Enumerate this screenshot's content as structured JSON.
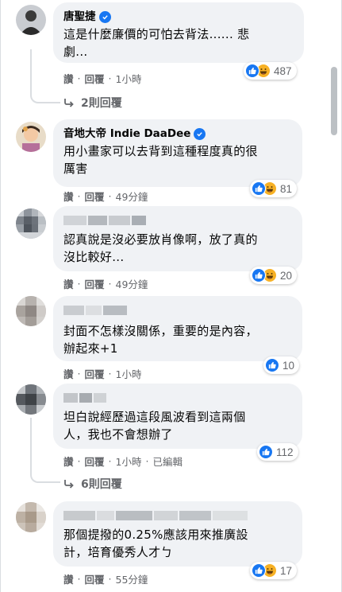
{
  "comments": [
    {
      "author": "唐聖捷",
      "verified": true,
      "text_lines": [
        "這是什麼廉價的可怕去背法...... 悲",
        "劇..."
      ],
      "reactions": {
        "icons": [
          "like-icon",
          "haha-icon"
        ],
        "count": "487"
      },
      "actions": {
        "like": "讚",
        "reply": "回覆",
        "time": "1小時"
      },
      "replies_label": "2則回覆"
    },
    {
      "author": "音地大帝 Indie DaaDee",
      "verified": true,
      "text_lines": [
        "用小畫家可以去背到這種程度真的很",
        "厲害"
      ],
      "reactions": {
        "icons": [
          "like-icon",
          "haha-icon"
        ],
        "count": "81"
      },
      "actions": {
        "like": "讚",
        "reply": "回覆",
        "time": "49分鐘"
      }
    },
    {
      "author": "",
      "verified": false,
      "text_lines": [
        "認真說是沒必要放肖像啊，放了真的",
        "沒比較好..."
      ],
      "reactions": {
        "icons": [
          "like-icon",
          "haha-icon"
        ],
        "count": "20"
      },
      "actions": {
        "like": "讚",
        "reply": "回覆",
        "time": "49分鐘"
      }
    },
    {
      "author": "",
      "verified": false,
      "text_lines": [
        "封面不怎樣沒關係，重要的是內容，",
        "辦起來+1"
      ],
      "reactions": {
        "icons": [
          "like-icon"
        ],
        "count": "10"
      },
      "actions": {
        "like": "讚",
        "reply": "回覆",
        "time": "1小時"
      }
    },
    {
      "author": "",
      "verified": false,
      "text_lines": [
        "坦白說經歷過這段風波看到這兩個",
        "人，我也不會想辦了"
      ],
      "reactions": {
        "icons": [
          "like-icon"
        ],
        "count": "112"
      },
      "actions": {
        "like": "讚",
        "reply": "回覆",
        "time": "1小時",
        "edited": "已編輯"
      },
      "replies_label": "6則回覆"
    },
    {
      "author": "",
      "verified": false,
      "text_lines": [
        "那個提撥的0.25%應該用來推廣設",
        "計，培育優秀人才ㄅ"
      ],
      "reactions": {
        "icons": [
          "like-icon",
          "haha-icon"
        ],
        "count": "17"
      },
      "actions": {
        "like": "讚",
        "reply": "回覆",
        "time": "55分鐘"
      }
    }
  ],
  "colors": {
    "bubble": "#f0f2f5",
    "link_blue": "#1877f2",
    "haha_yellow": "#f7b125",
    "secondary_text": "#65676b"
  }
}
